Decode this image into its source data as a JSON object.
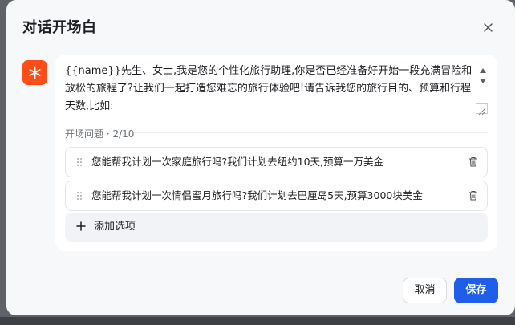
{
  "dialog": {
    "title": "对话开场白",
    "prologue_text": "{{name}}先生、女士,我是您的个性化旅行助理,你是否已经准备好开始一段充满冒险和放松的旅程了?让我们一起打造您难忘的旅行体验吧!请告诉我您的旅行目的、预算和行程天数,比如:",
    "questions_label": "开场问题 · 2/10",
    "questions": [
      {
        "text": "您能帮我计划一次家庭旅行吗?我们计划去纽约10天,预算一万美金"
      },
      {
        "text": "您能帮我计划一次情侣蜜月旅行吗?我们计划去巴厘岛5天,预算3000块美金"
      }
    ],
    "add_option_label": "添加选项",
    "cancel_label": "取消",
    "save_label": "保存"
  },
  "colors": {
    "accent": "#1f5ee8",
    "avatar": "#ff4d1a"
  },
  "icons": {
    "close": "close-icon",
    "avatar": "asterisk-icon",
    "drag": "drag-handle-icon",
    "delete": "trash-icon",
    "add": "plus-icon"
  }
}
